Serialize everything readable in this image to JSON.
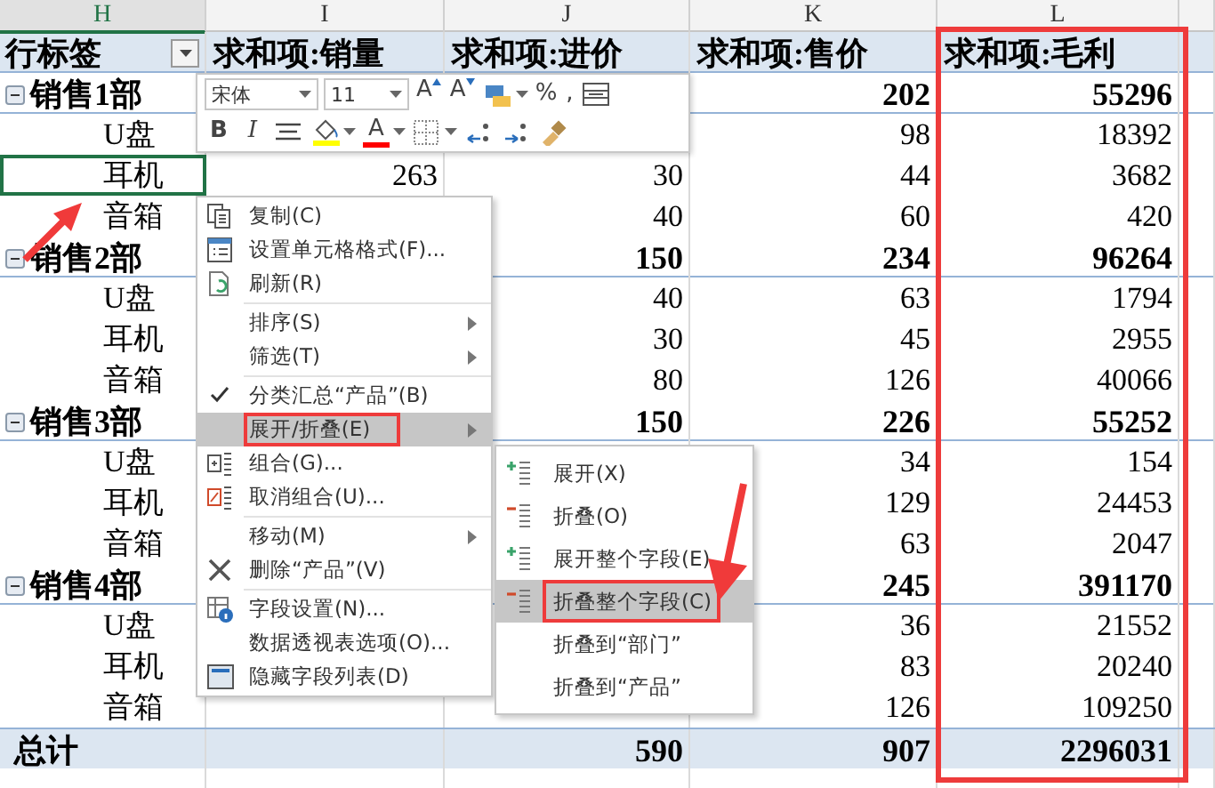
{
  "table": {
    "columns": [
      {
        "letter": "H",
        "selected": true,
        "marked": false
      },
      {
        "letter": "I",
        "selected": false,
        "marked": false
      },
      {
        "letter": "J",
        "selected": false,
        "marked": false
      },
      {
        "letter": "K",
        "selected": false,
        "marked": false
      },
      {
        "letter": "L",
        "selected": false,
        "marked": true
      }
    ],
    "header": {
      "label": "行标签",
      "values": [
        "求和项:销量",
        "求和项:进价",
        "求和项:售价",
        "求和项:毛利"
      ]
    },
    "rows": [
      {
        "kind": "group",
        "label": "销售1部",
        "expanded": true,
        "selected": false,
        "K": "202",
        "L": "55296"
      },
      {
        "kind": "item",
        "label": "U盘",
        "selected": false,
        "K": "98",
        "L": "18392"
      },
      {
        "kind": "item",
        "label": "耳机",
        "selected": true,
        "I": "263",
        "J": "30",
        "K": "44",
        "L": "3682"
      },
      {
        "kind": "item",
        "label": "音箱",
        "selected": false,
        "J": "40",
        "K": "60",
        "L": "420"
      },
      {
        "kind": "group",
        "label": "销售2部",
        "expanded": true,
        "selected": false,
        "J": "150",
        "K": "234",
        "L": "96264"
      },
      {
        "kind": "item",
        "label": "U盘",
        "selected": false,
        "J": "40",
        "K": "63",
        "L": "1794"
      },
      {
        "kind": "item",
        "label": "耳机",
        "selected": false,
        "J": "30",
        "K": "45",
        "L": "2955"
      },
      {
        "kind": "item",
        "label": "音箱",
        "selected": false,
        "J": "80",
        "K": "126",
        "L": "40066"
      },
      {
        "kind": "group",
        "label": "销售3部",
        "expanded": true,
        "selected": false,
        "J": "150",
        "K": "226",
        "L": "55252"
      },
      {
        "kind": "item",
        "label": "U盘",
        "selected": false,
        "K": "34",
        "L": "154"
      },
      {
        "kind": "item",
        "label": "耳机",
        "selected": false,
        "K": "129",
        "L": "24453"
      },
      {
        "kind": "item",
        "label": "音箱",
        "selected": false,
        "K": "63",
        "L": "2047"
      },
      {
        "kind": "group",
        "label": "销售4部",
        "expanded": true,
        "selected": false,
        "K": "245",
        "L": "391170"
      },
      {
        "kind": "item",
        "label": "U盘",
        "selected": false,
        "K": "36",
        "L": "21552"
      },
      {
        "kind": "item",
        "label": "耳机",
        "selected": false,
        "K": "83",
        "L": "20240"
      },
      {
        "kind": "item",
        "label": "音箱",
        "selected": false,
        "K": "126",
        "L": "109250"
      },
      {
        "kind": "total",
        "label": "总计",
        "selected": false,
        "J": "590",
        "K": "907",
        "L": "2296031"
      }
    ]
  },
  "mini_toolbar": {
    "font": "宋体",
    "size": "11",
    "row1": [
      {
        "kind": "grow_font",
        "label": "A"
      },
      {
        "kind": "shrink_font",
        "label": "A"
      },
      {
        "kind": "number_format"
      },
      {
        "kind": "percent",
        "label": "%"
      },
      {
        "kind": "comma",
        "label": ","
      },
      {
        "kind": "wrap"
      }
    ],
    "row2": [
      {
        "kind": "bold",
        "label": "B"
      },
      {
        "kind": "italic",
        "label": "I"
      },
      {
        "kind": "align"
      },
      {
        "kind": "fill_color",
        "color": "#ffff00"
      },
      {
        "kind": "font_color",
        "label": "A",
        "color": "#ff0000"
      },
      {
        "kind": "borders"
      },
      {
        "kind": "increase_decimal"
      },
      {
        "kind": "decrease_decimal"
      },
      {
        "kind": "format_painter"
      }
    ]
  },
  "context_menu": [
    {
      "kind": "copy",
      "label": "复制(C)",
      "submenu": false,
      "checked": false,
      "selected": false,
      "marked": false
    },
    {
      "kind": "format",
      "label": "设置单元格格式(F)...",
      "submenu": false,
      "checked": false,
      "selected": false,
      "marked": false
    },
    {
      "kind": "refresh",
      "label": "刷新(R)",
      "submenu": false,
      "checked": false,
      "selected": false,
      "marked": false
    },
    {
      "kind": "separator"
    },
    {
      "kind": "text",
      "label": "排序(S)",
      "submenu": true,
      "checked": false,
      "selected": false,
      "marked": false
    },
    {
      "kind": "text",
      "label": "筛选(T)",
      "submenu": true,
      "checked": false,
      "selected": false,
      "marked": false
    },
    {
      "kind": "separator"
    },
    {
      "kind": "text",
      "label": "分类汇总“产品”(B)",
      "submenu": false,
      "checked": true,
      "selected": false,
      "marked": false
    },
    {
      "kind": "text",
      "label": "展开/折叠(E)",
      "submenu": true,
      "checked": false,
      "selected": true,
      "marked": true
    },
    {
      "kind": "group",
      "label": "组合(G)...",
      "submenu": false,
      "checked": false,
      "selected": false,
      "marked": false
    },
    {
      "kind": "ungroup",
      "label": "取消组合(U)...",
      "submenu": false,
      "checked": false,
      "selected": false,
      "marked": false
    },
    {
      "kind": "separator"
    },
    {
      "kind": "text",
      "label": "移动(M)",
      "submenu": true,
      "checked": false,
      "selected": false,
      "marked": false
    },
    {
      "kind": "delete",
      "label": "删除“产品”(V)",
      "submenu": false,
      "checked": false,
      "selected": false,
      "marked": false
    },
    {
      "kind": "separator"
    },
    {
      "kind": "field",
      "label": "字段设置(N)...",
      "submenu": false,
      "checked": false,
      "selected": false,
      "marked": false
    },
    {
      "kind": "text",
      "label": "数据透视表选项(O)...",
      "submenu": false,
      "checked": false,
      "selected": false,
      "marked": false
    },
    {
      "kind": "hide",
      "label": "隐藏字段列表(D)",
      "submenu": false,
      "checked": false,
      "selected": false,
      "marked": false
    }
  ],
  "submenu": [
    {
      "kind": "expand",
      "label": "展开(X)",
      "selected": false,
      "marked": false
    },
    {
      "kind": "collapse",
      "label": "折叠(O)",
      "selected": false,
      "marked": false
    },
    {
      "kind": "expand",
      "label": "展开整个字段(E)",
      "selected": false,
      "marked": false
    },
    {
      "kind": "collapse",
      "label": "折叠整个字段(C)",
      "selected": true,
      "marked": true
    },
    {
      "kind": "text",
      "label": "折叠到“部门”",
      "selected": false,
      "marked": false
    },
    {
      "kind": "text",
      "label": "折叠到“产品”",
      "selected": false,
      "marked": false
    }
  ]
}
